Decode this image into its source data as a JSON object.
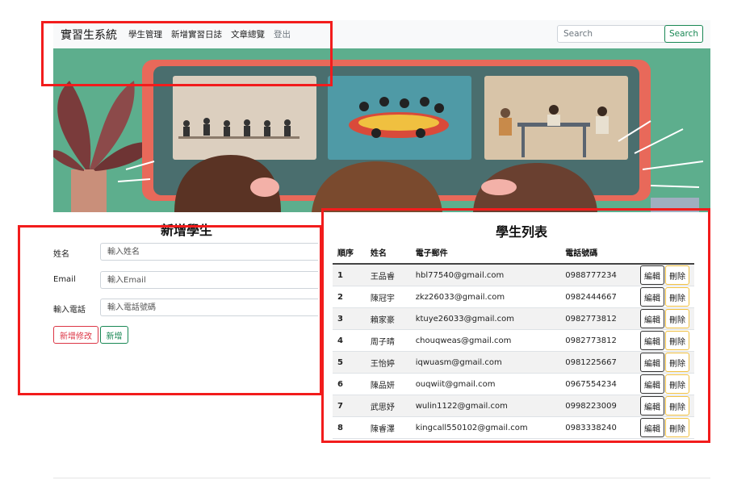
{
  "navbar": {
    "brand": "實習生系統",
    "links": [
      "學生管理",
      "新增實習日誌",
      "文章總覽"
    ],
    "logout": "登出",
    "search_placeholder": "Search",
    "search_button": "Search"
  },
  "form": {
    "title": "新增學生",
    "fields": [
      {
        "label": "姓名",
        "placeholder": "輸入姓名"
      },
      {
        "label": "Email",
        "placeholder": "輸入Email"
      },
      {
        "label": "輸入電話",
        "placeholder": "輸入電話號碼"
      }
    ],
    "edit_submit_button": "新增修改",
    "add_button": "新增"
  },
  "student_list": {
    "title": "學生列表",
    "headers": [
      "順序",
      "姓名",
      "電子郵件",
      "電話號碼"
    ],
    "edit_label": "編輯",
    "delete_label": "刪除",
    "rows": [
      {
        "idx": "1",
        "name": "王品睿",
        "email": "hbl77540@gmail.com",
        "phone": "0988777234"
      },
      {
        "idx": "2",
        "name": "陳冠宇",
        "email": "zkz26033@gmail.com",
        "phone": "0982444667"
      },
      {
        "idx": "3",
        "name": "賴家豪",
        "email": "ktuye26033@gmail.com",
        "phone": "0982773812"
      },
      {
        "idx": "4",
        "name": "周子晴",
        "email": "chouqweas@gmail.com",
        "phone": "0982773812"
      },
      {
        "idx": "5",
        "name": "王怡婷",
        "email": "iqwuasm@gmail.com",
        "phone": "0981225667"
      },
      {
        "idx": "6",
        "name": "陳品妍",
        "email": "ouqwiit@gmail.com",
        "phone": "0967554234"
      },
      {
        "idx": "7",
        "name": "武思妤",
        "email": "wulin1122@gmail.com",
        "phone": "0998223009"
      },
      {
        "idx": "8",
        "name": "陳睿澤",
        "email": "kingcall550102@gmail.com",
        "phone": "0983338240"
      }
    ]
  },
  "colors": {
    "annotation_red": "#f21c1c",
    "success_green": "#198754",
    "danger_red": "#dc3545",
    "warning_yellow": "#f0c040",
    "banner_green": "#5dae8d",
    "monitor_frame": "#e8695a"
  }
}
